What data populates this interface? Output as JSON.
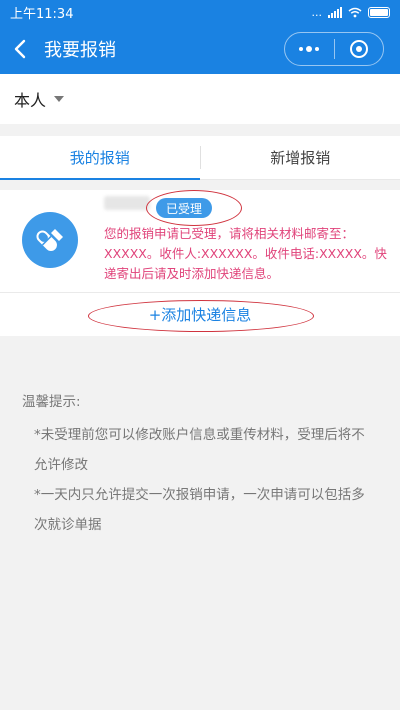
{
  "status_bar": {
    "time": "上午11:34",
    "network_speed": "...",
    "wifi_label": "Wi-Fi",
    "signal_icon": "signal-icon",
    "battery_icon": "battery-icon"
  },
  "header": {
    "title": "我要报销",
    "back_icon": "chevron-left-icon",
    "more_icon": "more-dots-icon",
    "close_icon": "target-icon"
  },
  "selector": {
    "label": "本人"
  },
  "tabs": [
    {
      "label": "我的报销",
      "active": true
    },
    {
      "label": "新增报销",
      "active": false
    }
  ],
  "record": {
    "status": "已受理",
    "icon": "medicine-capsule-icon",
    "notice": "您的报销申请已受理，请将相关材料邮寄至：XXXXX。收件人:XXXXXX。收件电话:XXXXX。快递寄出后请及时添加快递信息。",
    "add_button": "+添加快递信息"
  },
  "tips": {
    "title": "温馨提示:",
    "items": [
      "*未受理前您可以修改账户信息或重传材料，受理后将不允许修改",
      "*一天内只允许提交一次报销申请，一次申请可以包括多次就诊单据"
    ]
  },
  "colors": {
    "primary": "#1a82e2",
    "icon_blue": "#3e9ae8",
    "notice_pink": "#e0437a",
    "annotation_red": "#d0343f"
  }
}
